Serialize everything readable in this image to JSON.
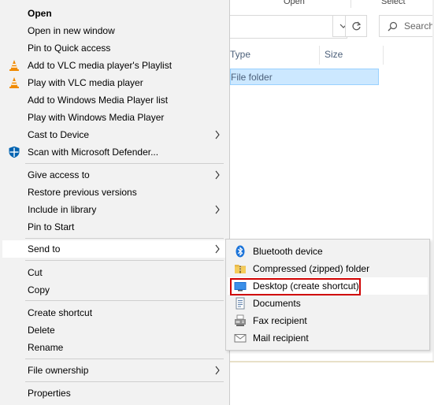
{
  "explorer": {
    "ribbon": {
      "open_label": "Open",
      "select_label": "Select"
    },
    "search_placeholder": "Search",
    "columns": {
      "type": "Type",
      "size": "Size"
    },
    "selected_row_type": "File folder",
    "nav_icons": {
      "dropdown": "chevron-down-icon",
      "refresh": "refresh-icon",
      "search": "search-icon"
    }
  },
  "context_menu": {
    "items": [
      {
        "label": "Open",
        "bold": true
      },
      {
        "label": "Open in new window"
      },
      {
        "label": "Pin to Quick access"
      },
      {
        "label": "Add to VLC media player's Playlist",
        "icon": "vlc-icon"
      },
      {
        "label": "Play with VLC media player",
        "icon": "vlc-icon"
      },
      {
        "label": "Add to Windows Media Player list"
      },
      {
        "label": "Play with Windows Media Player"
      },
      {
        "label": "Cast to Device",
        "submenu": true
      },
      {
        "label": "Scan with Microsoft Defender...",
        "icon": "defender-shield-icon"
      },
      {
        "label": "Give access to",
        "submenu": true
      },
      {
        "label": "Restore previous versions"
      },
      {
        "label": "Include in library",
        "submenu": true
      },
      {
        "label": "Pin to Start"
      },
      {
        "label": "Send to",
        "submenu": true,
        "highlighted": true
      },
      {
        "label": "Cut"
      },
      {
        "label": "Copy"
      },
      {
        "label": "Create shortcut"
      },
      {
        "label": "Delete"
      },
      {
        "label": "Rename"
      },
      {
        "label": "File ownership",
        "submenu": true
      },
      {
        "label": "Properties"
      }
    ]
  },
  "send_to_menu": {
    "items": [
      {
        "label": "Bluetooth device",
        "icon": "bluetooth-icon"
      },
      {
        "label": "Compressed (zipped) folder",
        "icon": "zip-folder-icon"
      },
      {
        "label": "Desktop (create shortcut)",
        "icon": "desktop-icon",
        "highlighted": true
      },
      {
        "label": "Documents",
        "icon": "documents-icon"
      },
      {
        "label": "Fax recipient",
        "icon": "fax-icon"
      },
      {
        "label": "Mail recipient",
        "icon": "mail-icon"
      }
    ]
  },
  "colors": {
    "menu_bg": "#f2f2f2",
    "highlight_bg": "#ffffff",
    "selection_bg": "#cce8ff",
    "annotation_red": "#d00000",
    "vlc_orange": "#f08a00",
    "defender_blue": "#0063b1"
  }
}
